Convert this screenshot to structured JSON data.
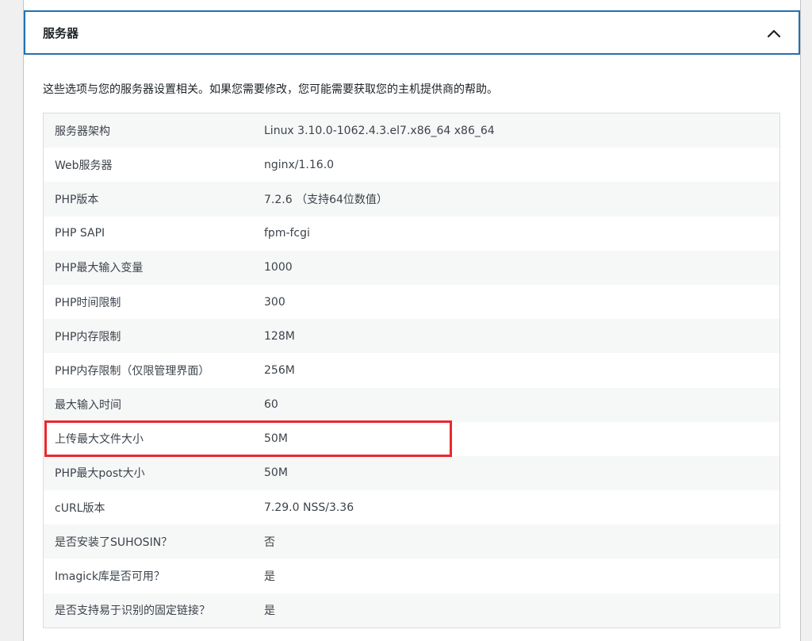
{
  "section": {
    "title": "服务器",
    "toggle_icon": "chevron-up-icon",
    "description": "这些选项与您的服务器设置相关。如果您需要修改，您可能需要获取您的主机提供商的帮助。"
  },
  "rows": [
    {
      "label": "服务器架构",
      "value": "Linux 3.10.0-1062.4.3.el7.x86_64 x86_64"
    },
    {
      "label": "Web服务器",
      "value": "nginx/1.16.0"
    },
    {
      "label": "PHP版本",
      "value": "7.2.6 （支持64位数值）"
    },
    {
      "label": "PHP SAPI",
      "value": "fpm-fcgi"
    },
    {
      "label": "PHP最大输入变量",
      "value": "1000"
    },
    {
      "label": "PHP时间限制",
      "value": "300"
    },
    {
      "label": "PHP内存限制",
      "value": "128M"
    },
    {
      "label": "PHP内存限制（仅限管理界面）",
      "value": "256M"
    },
    {
      "label": "最大输入时间",
      "value": "60"
    },
    {
      "label": "上传最大文件大小",
      "value": "50M"
    },
    {
      "label": "PHP最大post大小",
      "value": "50M"
    },
    {
      "label": "cURL版本",
      "value": "7.29.0 NSS/3.36"
    },
    {
      "label": "是否安装了SUHOSIN？",
      "value": "否"
    },
    {
      "label": "Imagick库是否可用？",
      "value": "是"
    },
    {
      "label": "是否支持易于识别的固定链接？",
      "value": "是"
    }
  ],
  "colors": {
    "accent": "#2271b1",
    "highlight": "#e8282d"
  }
}
